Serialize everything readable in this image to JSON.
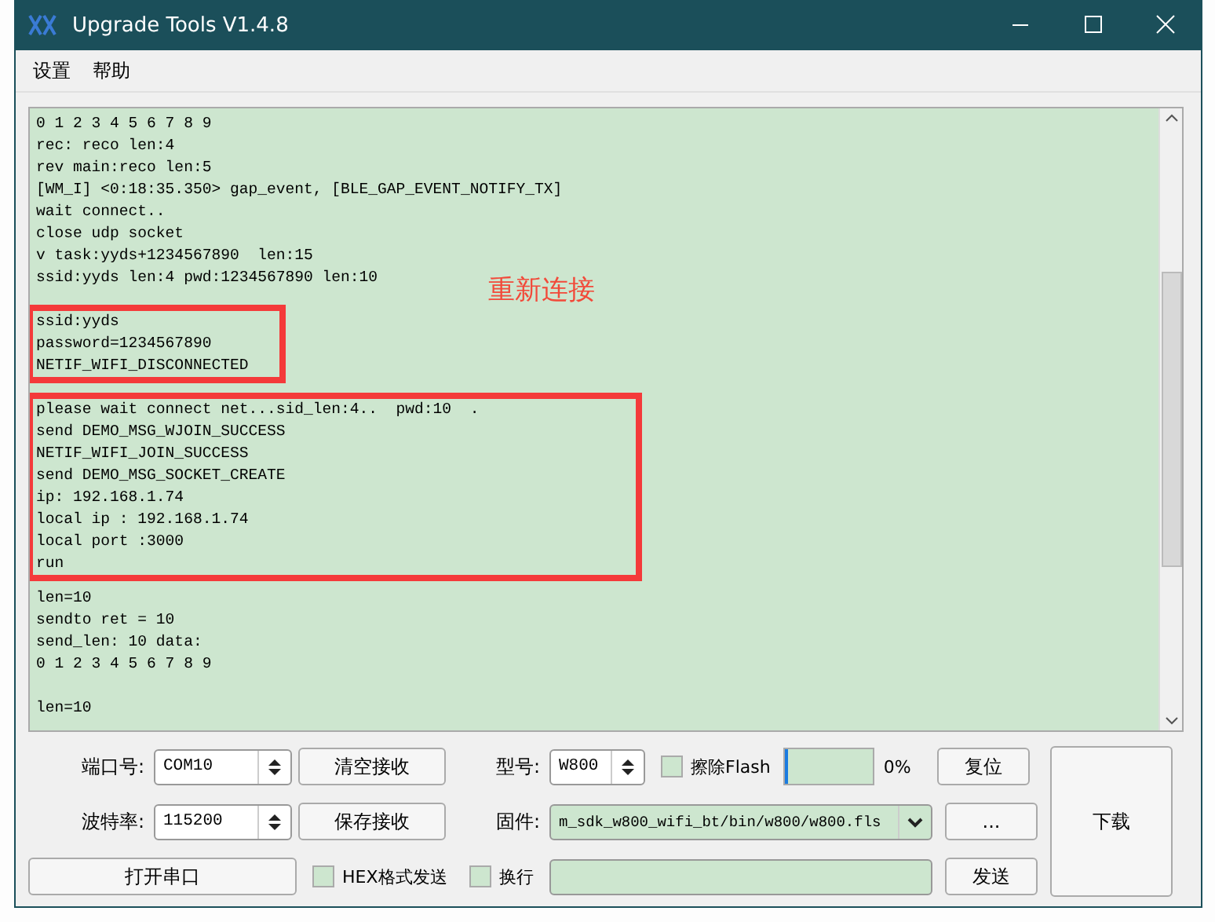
{
  "window": {
    "title": "Upgrade Tools V1.4.8"
  },
  "menu": [
    "设置",
    "帮助"
  ],
  "log": {
    "blocks": [
      {
        "highlighted": false,
        "lines": [
          "0 1 2 3 4 5 6 7 8 9",
          "rec: reco len:4",
          "rev main:reco len:5",
          "[WM_I] <0:18:35.350> gap_event, [BLE_GAP_EVENT_NOTIFY_TX]",
          "wait connect..",
          "close udp socket",
          "v task:yyds+1234567890  len:15",
          "ssid:yyds len:4 pwd:1234567890 len:10"
        ]
      },
      {
        "highlighted": true,
        "lines": [
          "ssid:yyds",
          "password=1234567890",
          "NETIF_WIFI_DISCONNECTED"
        ]
      },
      {
        "highlighted": true,
        "lines": [
          "please wait connect net...sid_len:4..  pwd:10  .",
          "send DEMO_MSG_WJOIN_SUCCESS",
          "NETIF_WIFI_JOIN_SUCCESS",
          "send DEMO_MSG_SOCKET_CREATE",
          "ip: 192.168.1.74",
          "local ip : 192.168.1.74",
          "local port :3000",
          "run"
        ]
      },
      {
        "highlighted": false,
        "lines": [
          "len=10",
          "sendto ret = 10",
          "send_len: 10 data:",
          "0 1 2 3 4 5 6 7 8 9"
        ]
      },
      {
        "highlighted": false,
        "lines": [
          "len=10"
        ]
      }
    ],
    "annotation": "重新连接"
  },
  "controls": {
    "port_label": "端口号:",
    "port": {
      "value": "COM10",
      "kind": "spin"
    },
    "clear_button": "清空接收",
    "model_label": "型号:",
    "model": {
      "value": "W800",
      "kind": "spin"
    },
    "erase_flash": {
      "label": "擦除Flash",
      "checked": false
    },
    "progress": {
      "level": 0.03,
      "reading": "0%"
    },
    "reset_button": "复位",
    "download_button": "下载",
    "baud_label": "波特率:",
    "baud": {
      "value": "115200",
      "kind": "spin"
    },
    "save_button": "保存接收",
    "firmware_label": "固件:",
    "firmware": {
      "value": "m_sdk_w800_wifi_bt/bin/w800/w800.fls",
      "kind": "dropdown"
    },
    "browse_button": "...",
    "open_button": "打开串口",
    "hex_send": {
      "label": "HEX格式发送",
      "checked": false
    },
    "newline": {
      "label": "换行",
      "checked": false
    },
    "send_button": "发送"
  }
}
